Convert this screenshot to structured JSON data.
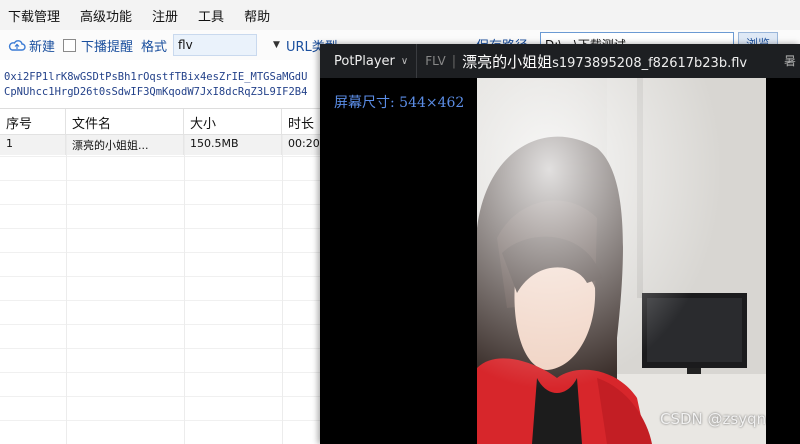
{
  "menu": [
    "下载管理",
    "高级功能",
    "注册",
    "工具",
    "帮助"
  ],
  "toolbar": {
    "new_label": "新建",
    "reminder_label": "下播提醒",
    "format_label": "格式",
    "format_value": "flv",
    "url_type_label": "URL类型",
    "path_label": "保存路径",
    "path_value": "D:\\...\\下载测试",
    "browse_label": "浏览"
  },
  "url_text": [
    "0xi2FP1lrK8wGSDtPsBh1rOqstfTBix4esZrIE_MTGSaMGdU",
    "CpNUhcc1HrgD26t0sSdwIF3QmKqodW7JxI8dcRqZ3L9IF2B4"
  ],
  "table": {
    "headers": [
      "序号",
      "文件名",
      "大小",
      "时长"
    ],
    "rows": [
      [
        "1",
        "漂亮的小姐姐...",
        "150.5MB",
        "00:20"
      ]
    ]
  },
  "player": {
    "app_name": "PotPlayer",
    "format": "FLV",
    "title_main": "漂亮的小姐姐",
    "title_file": "s1973895208_f82617b23b.flv",
    "extra": "暑",
    "osd_text": "屏幕尺寸: 544×462"
  },
  "watermark": "CSDN @zsyqn"
}
